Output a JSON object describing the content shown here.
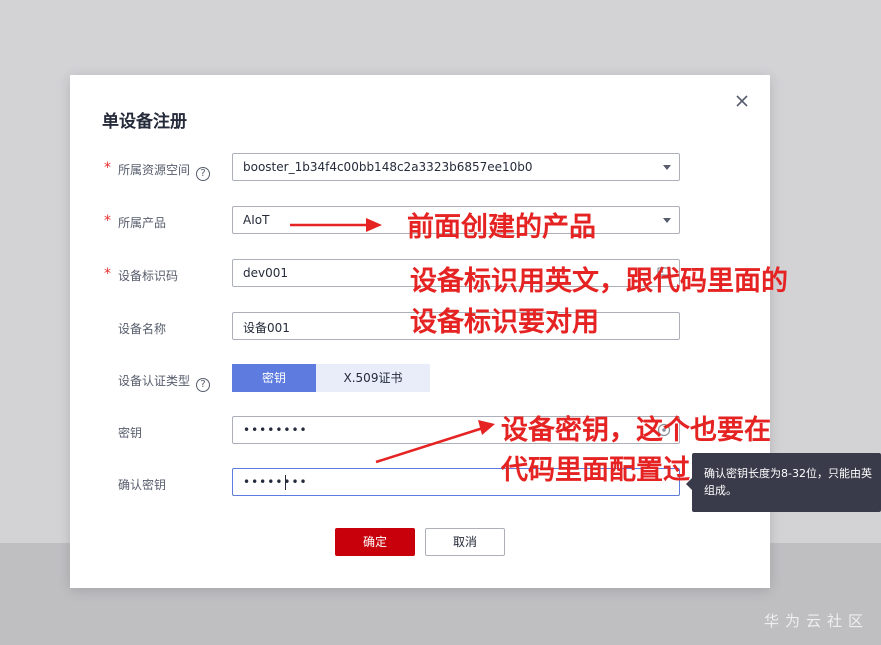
{
  "dialog": {
    "title": "单设备注册",
    "fields": {
      "space": {
        "label": "所属资源空间",
        "value": "booster_1b34f4c00bb148c2a3323b6857ee10b0"
      },
      "product": {
        "label": "所属产品",
        "value": "AIoT"
      },
      "identifier": {
        "label": "设备标识码",
        "value": "dev001"
      },
      "name": {
        "label": "设备名称",
        "value": "设备001"
      },
      "auth_type": {
        "label": "设备认证类型",
        "options": [
          "密钥",
          "X.509证书"
        ],
        "selected": "密钥"
      },
      "secret": {
        "label": "密钥",
        "value": "••••••••"
      },
      "confirm_secret": {
        "label": "确认密钥",
        "value": "••••••••"
      }
    },
    "help_icon": "?",
    "buttons": {
      "ok": "确定",
      "cancel": "取消"
    }
  },
  "tooltip": {
    "line1": "确认密钥长度为8-32位，只能由英",
    "line2": "组成。"
  },
  "annotations": {
    "product_note": "前面创建的产品",
    "identifier_note_1": "设备标识用英文，跟代码里面的",
    "identifier_note_2": "设备标识要对用",
    "secret_note_1": "设备密钥，这个也要在",
    "secret_note_2": "代码里面配置过"
  },
  "watermark": "华为云社区",
  "colors": {
    "accent": "#5e7ce0",
    "primary_button": "#c7000b",
    "required_star": "#e52c2c",
    "annotation": "#e52323"
  },
  "icons": [
    "close-icon",
    "help-icon",
    "chevron-down-icon",
    "card-icon",
    "eye-icon"
  ]
}
